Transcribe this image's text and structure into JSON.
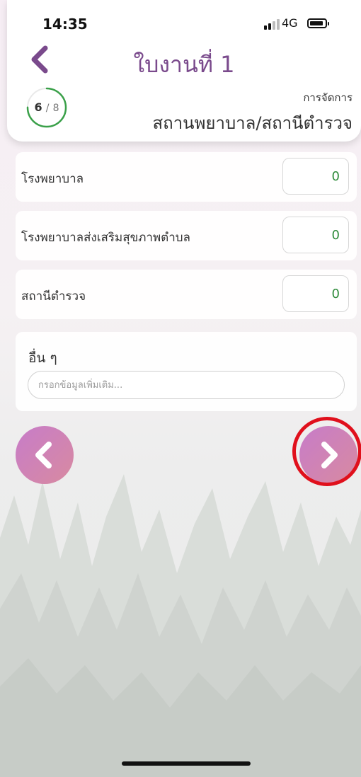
{
  "status_bar": {
    "time": "14:35",
    "network": "4G"
  },
  "header": {
    "title": "ใบงานที่ 1",
    "progress": {
      "current": "6",
      "separator": "/",
      "total": "8",
      "fraction": 0.75
    },
    "section_sub": "การจัดการ",
    "section_title": "สถานพยาบาล/สถานีตำรวจ"
  },
  "rows": [
    {
      "label": "โรงพยาบาล",
      "value": "0"
    },
    {
      "label": "โรงพยาบาลส่งเสริมสุขภาพตำบล",
      "value": "0"
    },
    {
      "label": "สถานีตำรวจ",
      "value": "0"
    }
  ],
  "other": {
    "label": "อื่น ๆ",
    "value": "",
    "placeholder": "กรอกข้อมูลเพิ่มเติม..."
  },
  "colors": {
    "accent": "#7a4a8c",
    "value_green": "#2e8b3a",
    "progress_green": "#3aa049",
    "highlight": "#e0101c"
  },
  "icons": {
    "back": "chevron-left-icon",
    "prev": "chevron-left-icon",
    "next": "chevron-right-icon"
  }
}
